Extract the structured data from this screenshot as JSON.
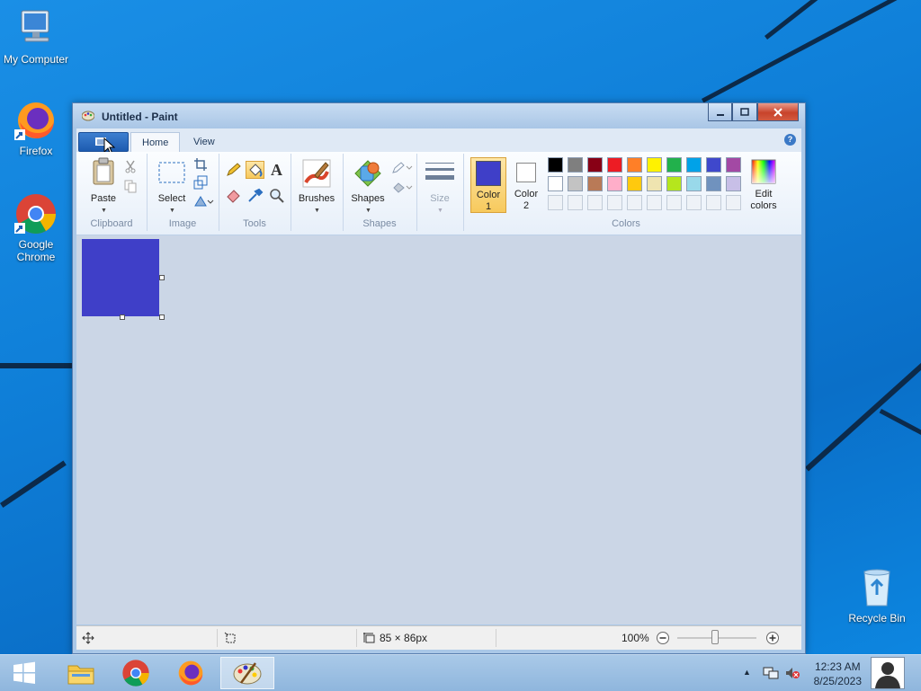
{
  "desktop": {
    "icons": [
      {
        "label": "My Computer"
      },
      {
        "label": "Firefox"
      },
      {
        "label": "Google Chrome"
      },
      {
        "label": "Recycle Bin"
      }
    ]
  },
  "window": {
    "title": "Untitled - Paint",
    "tabs": [
      {
        "label": "Home"
      },
      {
        "label": "View"
      }
    ],
    "help_icon": "?"
  },
  "ribbon": {
    "clipboard": {
      "group": "Clipboard",
      "paste": "Paste"
    },
    "image": {
      "group": "Image",
      "select": "Select"
    },
    "tools": {
      "group": "Tools",
      "text_tool": "A"
    },
    "brushes": {
      "label": "Brushes"
    },
    "shapes": {
      "group": "Shapes",
      "label": "Shapes"
    },
    "size": {
      "label": "Size"
    },
    "colors": {
      "group": "Colors",
      "color1_line1": "Color",
      "color1_line2": "1",
      "color2_line1": "Color",
      "color2_line2": "2",
      "edit_line1": "Edit",
      "edit_line2": "colors",
      "color1": "#3f3fc8",
      "color2": "#ffffff",
      "palette_row1": [
        "#000000",
        "#7f7f7f",
        "#880015",
        "#ed1c24",
        "#ff7f27",
        "#fff200",
        "#22b14c",
        "#00a2e8",
        "#3f48cc",
        "#a349a4"
      ],
      "palette_row2": [
        "#ffffff",
        "#c3c3c3",
        "#b97a57",
        "#ffaec9",
        "#ffc90e",
        "#efe4b0",
        "#b5e61d",
        "#99d9ea",
        "#7092be",
        "#c8bfe7"
      ]
    }
  },
  "canvas": {
    "fill": "#3f3fc8"
  },
  "statusbar": {
    "size_text": "85 × 86px",
    "zoom": "100%"
  },
  "taskbar": {
    "time": "12:23 AM",
    "date": "8/25/2023"
  }
}
